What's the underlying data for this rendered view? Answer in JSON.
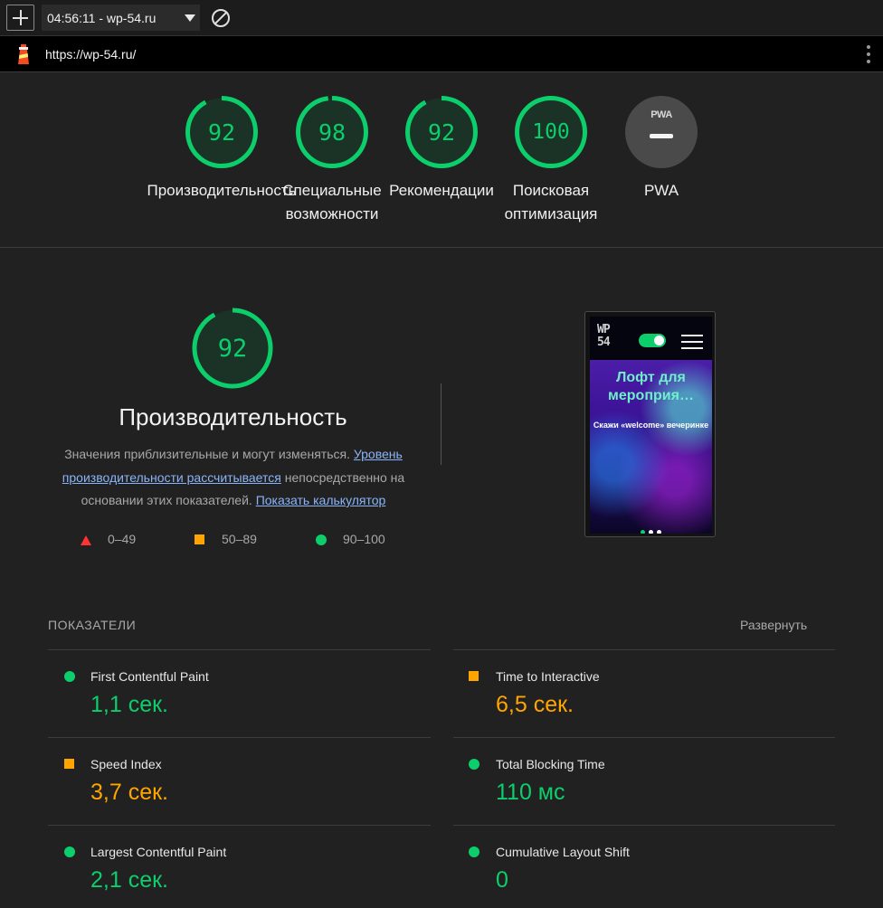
{
  "toolbar": {
    "report_label": "04:56:11 - wp-54.ru"
  },
  "urlbar": {
    "url": "https://wp-54.ru/"
  },
  "colors": {
    "pass": "#0cce6b",
    "average": "#ffa400",
    "fail": "#ff3333",
    "na": "#9e9e9e"
  },
  "categories": [
    {
      "score": 92,
      "label_line1": "Производительность",
      "label_line2": ""
    },
    {
      "score": 98,
      "label_line1": "Специальные",
      "label_line2": "возможности"
    },
    {
      "score": 92,
      "label_line1": "Рекомендации",
      "label_line2": ""
    },
    {
      "score": 100,
      "label_line1": "Поисковая",
      "label_line2": "оптимизация"
    },
    {
      "score": null,
      "badge": "PWA",
      "label_line1": "PWA",
      "label_line2": ""
    }
  ],
  "performance": {
    "score": 92,
    "title": "Производительность",
    "desc_text1": "Значения приблизительные и могут изменяться.",
    "desc_link1": "Уровень производительности рассчитывается",
    "desc_text2": "непосредственно на основании этих показателей.",
    "desc_link2": "Показать калькулятор",
    "legend": [
      {
        "icon": "fail-triangle-icon",
        "range": "0–49"
      },
      {
        "icon": "average-square-icon",
        "range": "50–89"
      },
      {
        "icon": "pass-circle-icon",
        "range": "90–100"
      }
    ]
  },
  "screenshot": {
    "logo_line1": "WP",
    "logo_line2": "54",
    "hero_title": "Лофт для мероприя…",
    "hero_sub": "Скажи «welcome» вечеринке"
  },
  "metrics": {
    "header": "ПОКАЗАТЕЛИ",
    "expand": "Развернуть",
    "items": [
      {
        "name": "First Contentful Paint",
        "value": "1,1 сек.",
        "status": "pass"
      },
      {
        "name": "Time to Interactive",
        "value": "6,5 сек.",
        "status": "average"
      },
      {
        "name": "Speed Index",
        "value": "3,7 сек.",
        "status": "average"
      },
      {
        "name": "Total Blocking Time",
        "value": "110 мс",
        "status": "pass"
      },
      {
        "name": "Largest Contentful Paint",
        "value": "2,1 сек.",
        "status": "pass"
      },
      {
        "name": "Cumulative Layout Shift",
        "value": "0",
        "status": "pass"
      }
    ]
  }
}
